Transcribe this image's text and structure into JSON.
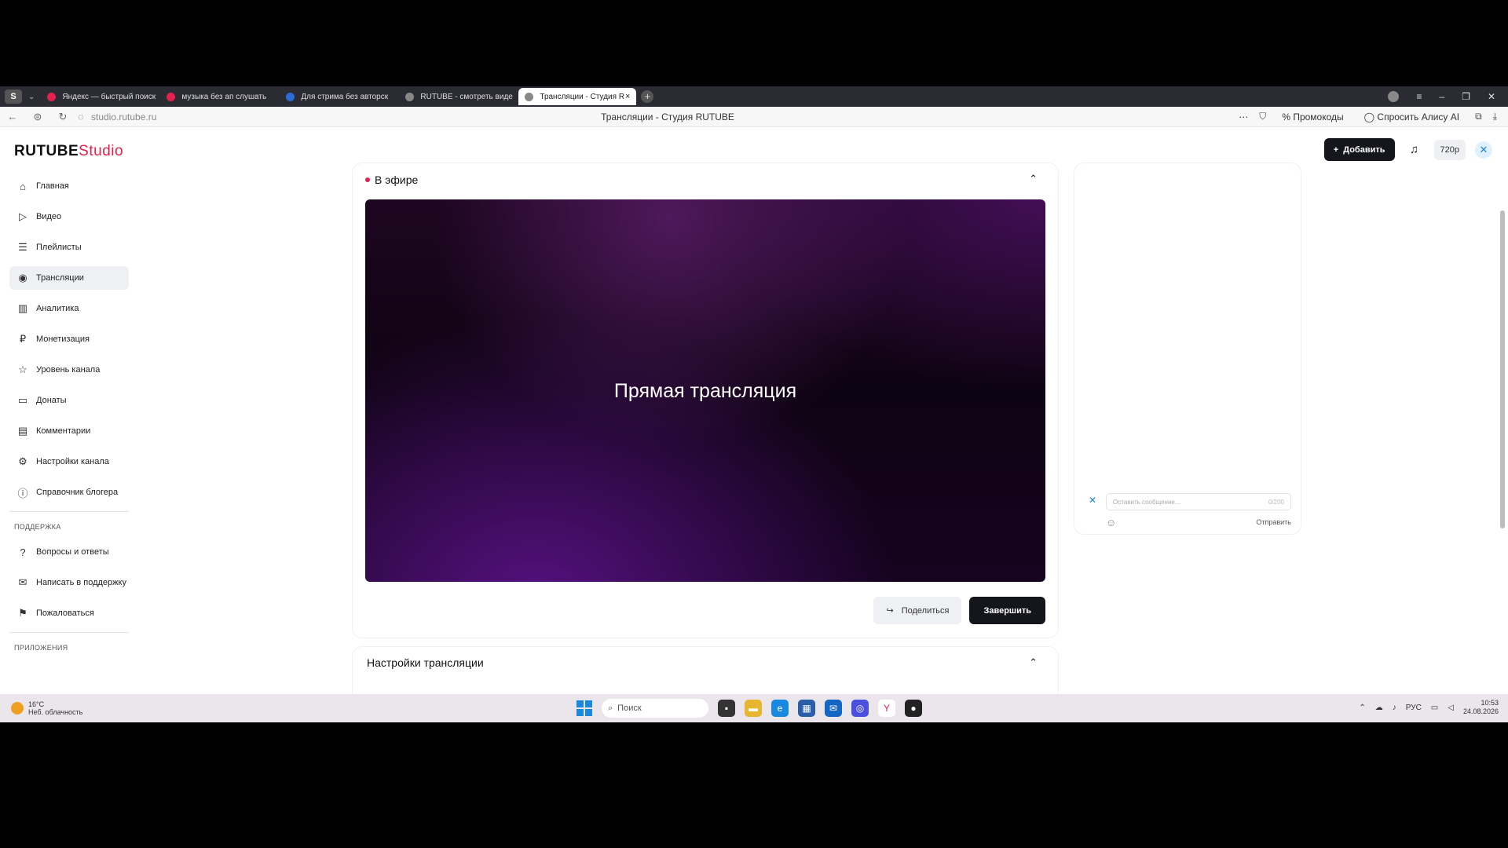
{
  "browser": {
    "tabs": [
      {
        "label": "Яндекс — быстрый поиск",
        "color": "#e5204e"
      },
      {
        "label": "музыка без ап слушать",
        "color": "#e5204e"
      },
      {
        "label": "Для стрима без авторск",
        "color": "#2a6bd8"
      },
      {
        "label": "RUTUBE - смотреть виде",
        "color": "#888888"
      },
      {
        "label": "Трансляции - Студия R",
        "color": "#888888"
      }
    ],
    "url": "studio.rutube.ru",
    "page_title": "Трансляции - Студия RUTUBE",
    "promo": "Промокоды",
    "ask_alice": "Спросить Алису AI"
  },
  "brand": {
    "main": "RUTUBE",
    "studio": "Studio"
  },
  "topbar": {
    "add_label": "Добавить",
    "quality": "720p"
  },
  "sidebar": {
    "items": [
      {
        "label": "Главная",
        "icon": "⌂"
      },
      {
        "label": "Видео",
        "icon": "▷"
      },
      {
        "label": "Плейлисты",
        "icon": "☰"
      },
      {
        "label": "Трансляции",
        "icon": "◉"
      },
      {
        "label": "Аналитика",
        "icon": "▥"
      },
      {
        "label": "Монетизация",
        "icon": "₽"
      },
      {
        "label": "Уровень канала",
        "icon": "☆"
      },
      {
        "label": "Донаты",
        "icon": "▭"
      },
      {
        "label": "Комментарии",
        "icon": "▤"
      },
      {
        "label": "Настройки канала",
        "icon": "⚙"
      },
      {
        "label": "Справочник блогера",
        "icon": "ⓘ"
      }
    ],
    "support_heading": "ПОДДЕРЖКА",
    "support": [
      {
        "label": "Вопросы и ответы",
        "icon": "?"
      },
      {
        "label": "Написать в поддержку",
        "icon": "✉"
      },
      {
        "label": "Пожаловаться",
        "icon": "⚑"
      }
    ],
    "apps_heading": "ПРИЛОЖЕНИЯ"
  },
  "stream": {
    "status": "В эфире",
    "player_title": "Прямая трансляция",
    "share_label": "Поделиться",
    "end_label": "Завершить",
    "settings_title": "Настройки трансляции"
  },
  "chat": {
    "placeholder": "Оставить сообщение...",
    "counter": "0/200",
    "send_label": "Отправить"
  },
  "taskbar": {
    "temperature": "16°C",
    "weather": "Неб. облачность",
    "search": "Поиск",
    "lang": "РУС",
    "time": "10:53",
    "date": "24.08.2026"
  }
}
